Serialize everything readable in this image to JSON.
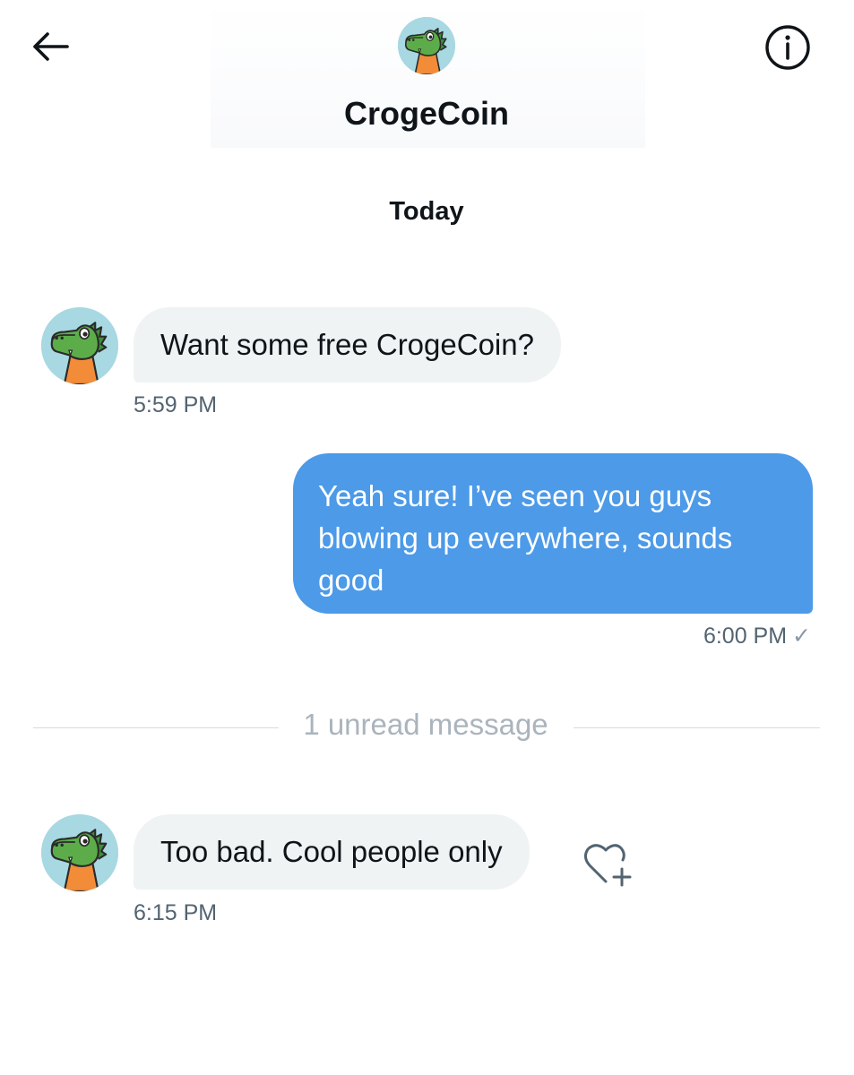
{
  "header": {
    "name": "CrogeCoin",
    "back_icon": "arrow-left-icon",
    "info_icon": "info-circle-icon"
  },
  "conversation": {
    "date_label": "Today",
    "messages": [
      {
        "direction": "incoming",
        "text": "Want some free CrogeCoin?",
        "time": "5:59 PM"
      },
      {
        "direction": "outgoing",
        "text": "Yeah sure! I’ve seen you guys blowing up everywhere, sounds good",
        "time": "6:00 PM",
        "status_icon": "check-icon"
      },
      {
        "direction": "incoming",
        "text": "Too bad. Cool people only",
        "time": "6:15 PM",
        "reaction_icon": "heart-plus-icon"
      }
    ],
    "unread_divider": "1 unread message"
  },
  "colors": {
    "outgoing_bubble": "#4c9ae8",
    "incoming_bubble": "#eff3f4",
    "secondary_text": "#536471",
    "avatar_background": "#a8d8e2",
    "avatar_crocodile": "#5cad4a",
    "avatar_body": "#f28c38"
  }
}
